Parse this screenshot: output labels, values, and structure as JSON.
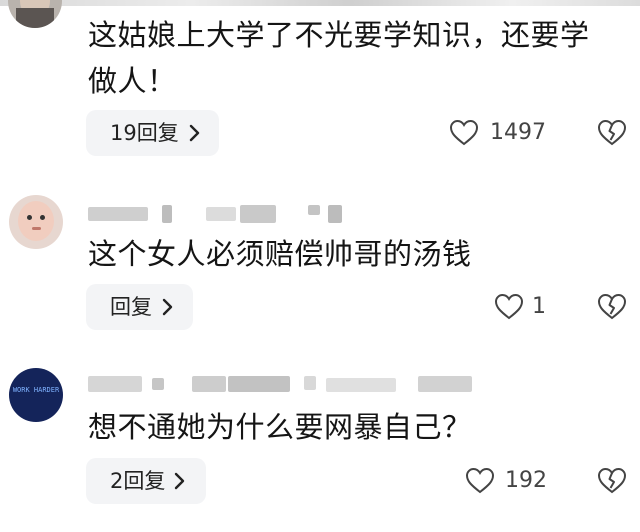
{
  "comments": [
    {
      "text_line1": "这姑娘上大学了不光要学知识，还要学",
      "text_line2": "做人！",
      "reply": "19回复",
      "likes": "1497"
    },
    {
      "text_line1": "这个女人必须赔偿帅哥的汤钱",
      "reply": "回复",
      "likes": "1"
    },
    {
      "text_line1": "想不通她为什么要网暴自己？",
      "reply": "2回复",
      "likes": "192",
      "avatar_text": "WORK HARDER"
    }
  ],
  "icons": {
    "chevron": "chevron-right-icon",
    "like": "heart-icon",
    "dislike": "broken-heart-icon"
  },
  "colors": {
    "reply_bg": "#f3f4f6",
    "text": "#151515",
    "avatar3_bg": "#14245a",
    "avatar3_text": "#7fb2ff"
  }
}
